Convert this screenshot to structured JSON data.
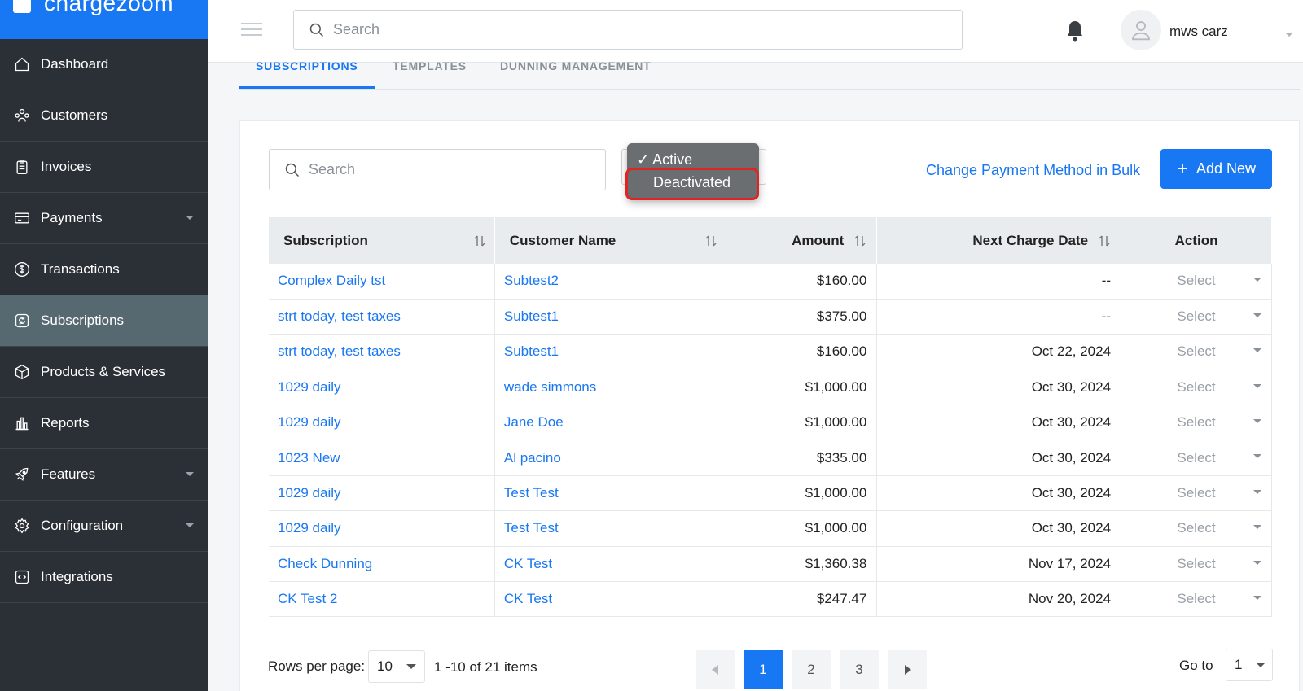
{
  "app": {
    "logo_text": "chargezoom"
  },
  "sidebar": {
    "items": [
      {
        "label": "Dashboard",
        "icon": "home-icon"
      },
      {
        "label": "Customers",
        "icon": "users-icon"
      },
      {
        "label": "Invoices",
        "icon": "clipboard-icon"
      },
      {
        "label": "Payments",
        "icon": "credit-card-icon",
        "has_submenu": true
      },
      {
        "label": "Transactions",
        "icon": "dollar-circle-icon"
      },
      {
        "label": "Subscriptions",
        "icon": "refresh-icon",
        "active": true
      },
      {
        "label": "Products & Services",
        "icon": "box-icon"
      },
      {
        "label": "Reports",
        "icon": "bar-chart-icon"
      },
      {
        "label": "Features",
        "icon": "rocket-icon",
        "has_submenu": true
      },
      {
        "label": "Configuration",
        "icon": "gear-icon",
        "has_submenu": true
      },
      {
        "label": "Integrations",
        "icon": "code-icon"
      }
    ]
  },
  "header": {
    "search_placeholder": "Search",
    "user_name": "mws carz"
  },
  "tabs": [
    {
      "label": "SUBSCRIPTIONS",
      "active": true
    },
    {
      "label": "TEMPLATES",
      "active": false
    },
    {
      "label": "DUNNING MANAGEMENT",
      "active": false
    }
  ],
  "toolbar": {
    "search_placeholder": "Search",
    "bulk_link": "Change Payment Method in Bulk",
    "add_new": "Add New"
  },
  "status_dropdown": {
    "options": [
      "✓ Active",
      "Deactivated"
    ],
    "selected": "Active",
    "highlighted": "Deactivated"
  },
  "table": {
    "columns": [
      "Subscription",
      "Customer Name",
      "Amount",
      "Next Charge Date",
      "Action"
    ],
    "rows": [
      {
        "subscription": "Complex Daily tst",
        "customer": "Subtest2",
        "amount": "$160.00",
        "next_charge": "--",
        "action": "Select"
      },
      {
        "subscription": "strt today, test taxes",
        "customer": "Subtest1",
        "amount": "$375.00",
        "next_charge": "--",
        "action": "Select"
      },
      {
        "subscription": "strt today, test taxes",
        "customer": "Subtest1",
        "amount": "$160.00",
        "next_charge": "Oct 22, 2024",
        "action": "Select"
      },
      {
        "subscription": "1029 daily",
        "customer": "wade simmons",
        "amount": "$1,000.00",
        "next_charge": "Oct 30, 2024",
        "action": "Select"
      },
      {
        "subscription": "1029 daily",
        "customer": "Jane Doe",
        "amount": "$1,000.00",
        "next_charge": "Oct 30, 2024",
        "action": "Select"
      },
      {
        "subscription": "1023 New",
        "customer": "Al pacino",
        "amount": "$335.00",
        "next_charge": "Oct 30, 2024",
        "action": "Select"
      },
      {
        "subscription": "1029 daily",
        "customer": "Test Test",
        "amount": "$1,000.00",
        "next_charge": "Oct 30, 2024",
        "action": "Select"
      },
      {
        "subscription": "1029 daily",
        "customer": "Test Test",
        "amount": "$1,000.00",
        "next_charge": "Oct 30, 2024",
        "action": "Select"
      },
      {
        "subscription": "Check Dunning",
        "customer": "CK Test",
        "amount": "$1,360.38",
        "next_charge": "Nov 17, 2024",
        "action": "Select"
      },
      {
        "subscription": "CK Test 2",
        "customer": "CK Test",
        "amount": "$247.47",
        "next_charge": "Nov 20, 2024",
        "action": "Select"
      }
    ]
  },
  "pagination": {
    "rows_label": "Rows per page:",
    "rows_value": "10",
    "range_text": "1 -10 of 21  items",
    "pages": [
      "1",
      "2",
      "3"
    ],
    "current_page": "1",
    "goto_label": "Go to",
    "goto_value": "1"
  },
  "colors": {
    "accent": "#1877f2",
    "sidebar_bg": "#2b3036",
    "sidebar_active": "#566870",
    "highlight": "#e02424"
  }
}
